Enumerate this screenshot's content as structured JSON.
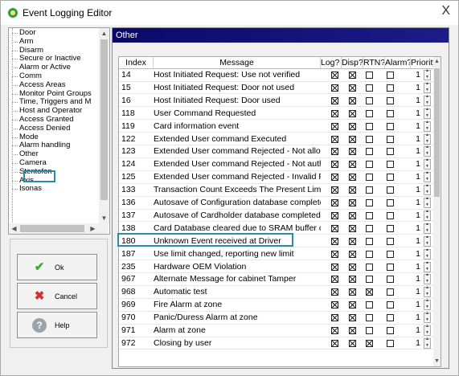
{
  "window": {
    "title": "Event Logging Editor",
    "close_glyph": "X"
  },
  "tree": {
    "items": [
      "Door",
      "Arm",
      "Disarm",
      "Secure or Inactive",
      "Alarm or Active",
      "Comm",
      "Access Areas",
      "Monitor Point Groups",
      "Time, Triggers and M",
      "Host and Operator",
      "Access Granted",
      "Access Denied",
      "Mode",
      "Alarm handling",
      "Other",
      "Camera",
      "Stentofon",
      "Axis",
      "Isonas"
    ],
    "selected": "Other"
  },
  "buttons": {
    "ok": "Ok",
    "cancel": "Cancel",
    "help": "Help"
  },
  "panel": {
    "title": "Other"
  },
  "grid": {
    "columns": [
      "Index",
      "Message",
      "Log?",
      "Disp?",
      "RTN?",
      "Alarm?",
      "Priority"
    ],
    "rows": [
      {
        "index": "14",
        "message": "Host Initiated Request: Use not verified",
        "log": true,
        "disp": true,
        "rtn": false,
        "alarm": false,
        "priority": "1"
      },
      {
        "index": "15",
        "message": "Host Initiated Request: Door not used",
        "log": true,
        "disp": true,
        "rtn": false,
        "alarm": false,
        "priority": "1"
      },
      {
        "index": "16",
        "message": "Host Initiated Request: Door used",
        "log": true,
        "disp": true,
        "rtn": false,
        "alarm": false,
        "priority": "1"
      },
      {
        "index": "118",
        "message": "User Command Requested",
        "log": true,
        "disp": true,
        "rtn": false,
        "alarm": false,
        "priority": "1"
      },
      {
        "index": "119",
        "message": "Card information event",
        "log": true,
        "disp": true,
        "rtn": false,
        "alarm": false,
        "priority": "1"
      },
      {
        "index": "122",
        "message": "Extended User command Executed",
        "log": true,
        "disp": true,
        "rtn": false,
        "alarm": false,
        "priority": "1"
      },
      {
        "index": "123",
        "message": "Extended User command Rejected - Not allow",
        "log": true,
        "disp": true,
        "rtn": false,
        "alarm": false,
        "priority": "1"
      },
      {
        "index": "124",
        "message": "Extended User command Rejected - Not authc",
        "log": true,
        "disp": true,
        "rtn": false,
        "alarm": false,
        "priority": "1"
      },
      {
        "index": "125",
        "message": "Extended User command Rejected - Invalid Pa",
        "log": true,
        "disp": true,
        "rtn": false,
        "alarm": false,
        "priority": "1"
      },
      {
        "index": "133",
        "message": "Transaction Count Exceeds The Present Limit",
        "log": true,
        "disp": true,
        "rtn": false,
        "alarm": false,
        "priority": "1"
      },
      {
        "index": "136",
        "message": "Autosave of Configuration database complete",
        "log": true,
        "disp": true,
        "rtn": false,
        "alarm": false,
        "priority": "1"
      },
      {
        "index": "137",
        "message": "Autosave of Cardholder database completed",
        "log": true,
        "disp": true,
        "rtn": false,
        "alarm": false,
        "priority": "1"
      },
      {
        "index": "138",
        "message": "Card Database cleared due to SRAM buffer ov",
        "log": true,
        "disp": true,
        "rtn": false,
        "alarm": false,
        "priority": "1"
      },
      {
        "index": "180",
        "message": "Unknown Event received at Driver",
        "log": true,
        "disp": true,
        "rtn": false,
        "alarm": false,
        "priority": "1"
      },
      {
        "index": "187",
        "message": "Use limit changed, reporting new limit",
        "log": true,
        "disp": true,
        "rtn": false,
        "alarm": false,
        "priority": "1"
      },
      {
        "index": "235",
        "message": "Hardware OEM Violation",
        "log": true,
        "disp": true,
        "rtn": false,
        "alarm": false,
        "priority": "1"
      },
      {
        "index": "967",
        "message": "Alternate Message for cabinet Tamper",
        "log": true,
        "disp": true,
        "rtn": false,
        "alarm": false,
        "priority": "1"
      },
      {
        "index": "968",
        "message": "Automatic test",
        "log": true,
        "disp": true,
        "rtn": true,
        "alarm": false,
        "priority": "1"
      },
      {
        "index": "969",
        "message": "Fire Alarm at zone",
        "log": true,
        "disp": true,
        "rtn": false,
        "alarm": false,
        "priority": "1"
      },
      {
        "index": "970",
        "message": "Panic/Duress Alarm at zone",
        "log": true,
        "disp": true,
        "rtn": false,
        "alarm": false,
        "priority": "1"
      },
      {
        "index": "971",
        "message": "Alarm at zone",
        "log": true,
        "disp": true,
        "rtn": false,
        "alarm": false,
        "priority": "1"
      },
      {
        "index": "972",
        "message": "Closing by user",
        "log": true,
        "disp": true,
        "rtn": true,
        "alarm": false,
        "priority": "1"
      }
    ],
    "highlighted_index": "180"
  },
  "colors": {
    "highlight": "#2d8ba5",
    "panel_header": "#0a0a6a"
  }
}
